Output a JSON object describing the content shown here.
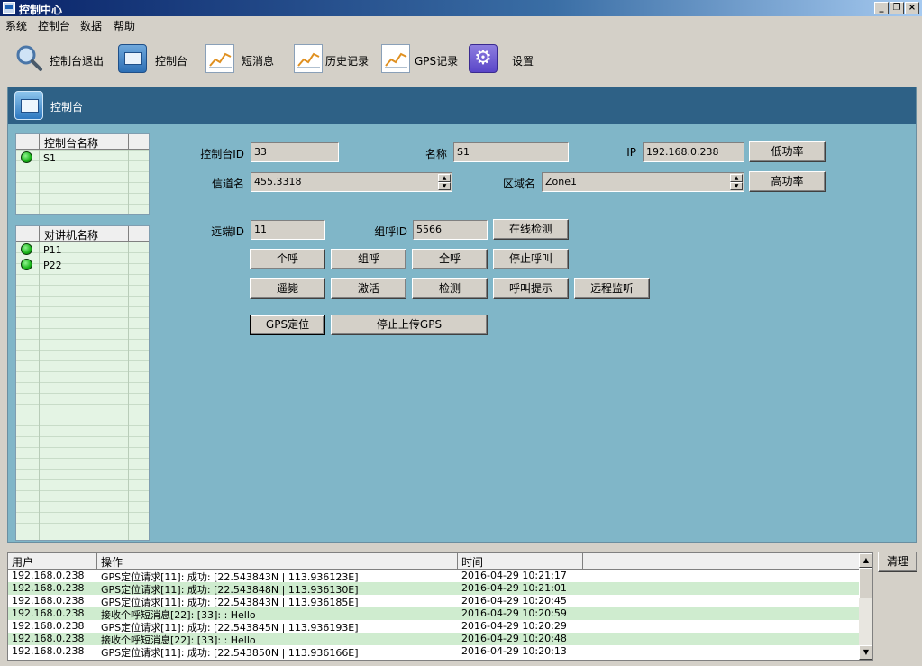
{
  "window": {
    "title": "控制中心"
  },
  "menu": [
    "系统",
    "控制台",
    "数据",
    "帮助"
  ],
  "toolbar": [
    {
      "label": "控制台退出",
      "icon": "search-icon"
    },
    {
      "label": "控制台",
      "icon": "monitor-icon"
    },
    {
      "label": "短消息",
      "icon": "chart-icon"
    },
    {
      "label": "历史记录",
      "icon": "chart-icon"
    },
    {
      "label": "GPS记录",
      "icon": "chart-icon"
    },
    {
      "label": "设置",
      "icon": "gear-icon"
    }
  ],
  "panel": {
    "title": "控制台"
  },
  "console_list": {
    "header": "控制台名称",
    "items": [
      {
        "name": "S1",
        "status": "online"
      }
    ]
  },
  "radio_list": {
    "header": "对讲机名称",
    "items": [
      {
        "name": "P11",
        "status": "online"
      },
      {
        "name": "P22",
        "status": "online"
      }
    ]
  },
  "form": {
    "console_id": {
      "label": "控制台ID",
      "value": "33"
    },
    "name": {
      "label": "名称",
      "value": "S1"
    },
    "ip": {
      "label": "IP",
      "value": "192.168.0.238"
    },
    "channel": {
      "label": "信道名",
      "value": "455.3318"
    },
    "zone": {
      "label": "区域名",
      "value": "Zone1"
    },
    "remote_id": {
      "label": "远端ID",
      "value": "11"
    },
    "group_id": {
      "label": "组呼ID",
      "value": "5566"
    }
  },
  "buttons": {
    "low_power": "低功率",
    "high_power": "高功率",
    "online_check": "在线检测",
    "individual_call": "个呼",
    "group_call": "组呼",
    "all_call": "全呼",
    "stop_call": "停止呼叫",
    "stun": "遥毙",
    "revive": "激活",
    "check": "检测",
    "call_alert": "呼叫提示",
    "remote_monitor": "远程监听",
    "gps_locate": "GPS定位",
    "stop_gps": "停止上传GPS",
    "clear": "清理"
  },
  "log": {
    "columns": [
      "用户",
      "操作",
      "时间"
    ],
    "rows": [
      {
        "user": "192.168.0.238",
        "op": "GPS定位请求[11]: 成功: [22.543843N | 113.936123E]",
        "time": "2016-04-29 10:21:17"
      },
      {
        "user": "192.168.0.238",
        "op": "GPS定位请求[11]: 成功: [22.543848N | 113.936130E]",
        "time": "2016-04-29 10:21:01"
      },
      {
        "user": "192.168.0.238",
        "op": "GPS定位请求[11]: 成功: [22.543843N | 113.936185E]",
        "time": "2016-04-29 10:20:45"
      },
      {
        "user": "192.168.0.238",
        "op": "接收个呼短消息[22]: [33]: : Hello",
        "time": "2016-04-29 10:20:59"
      },
      {
        "user": "192.168.0.238",
        "op": "GPS定位请求[11]: 成功: [22.543845N | 113.936193E]",
        "time": "2016-04-29 10:20:29"
      },
      {
        "user": "192.168.0.238",
        "op": "接收个呼短消息[22]: [33]: : Hello",
        "time": "2016-04-29 10:20:48"
      },
      {
        "user": "192.168.0.238",
        "op": "GPS定位请求[11]: 成功: [22.543850N | 113.936166E]",
        "time": "2016-04-29 10:20:13"
      }
    ]
  }
}
